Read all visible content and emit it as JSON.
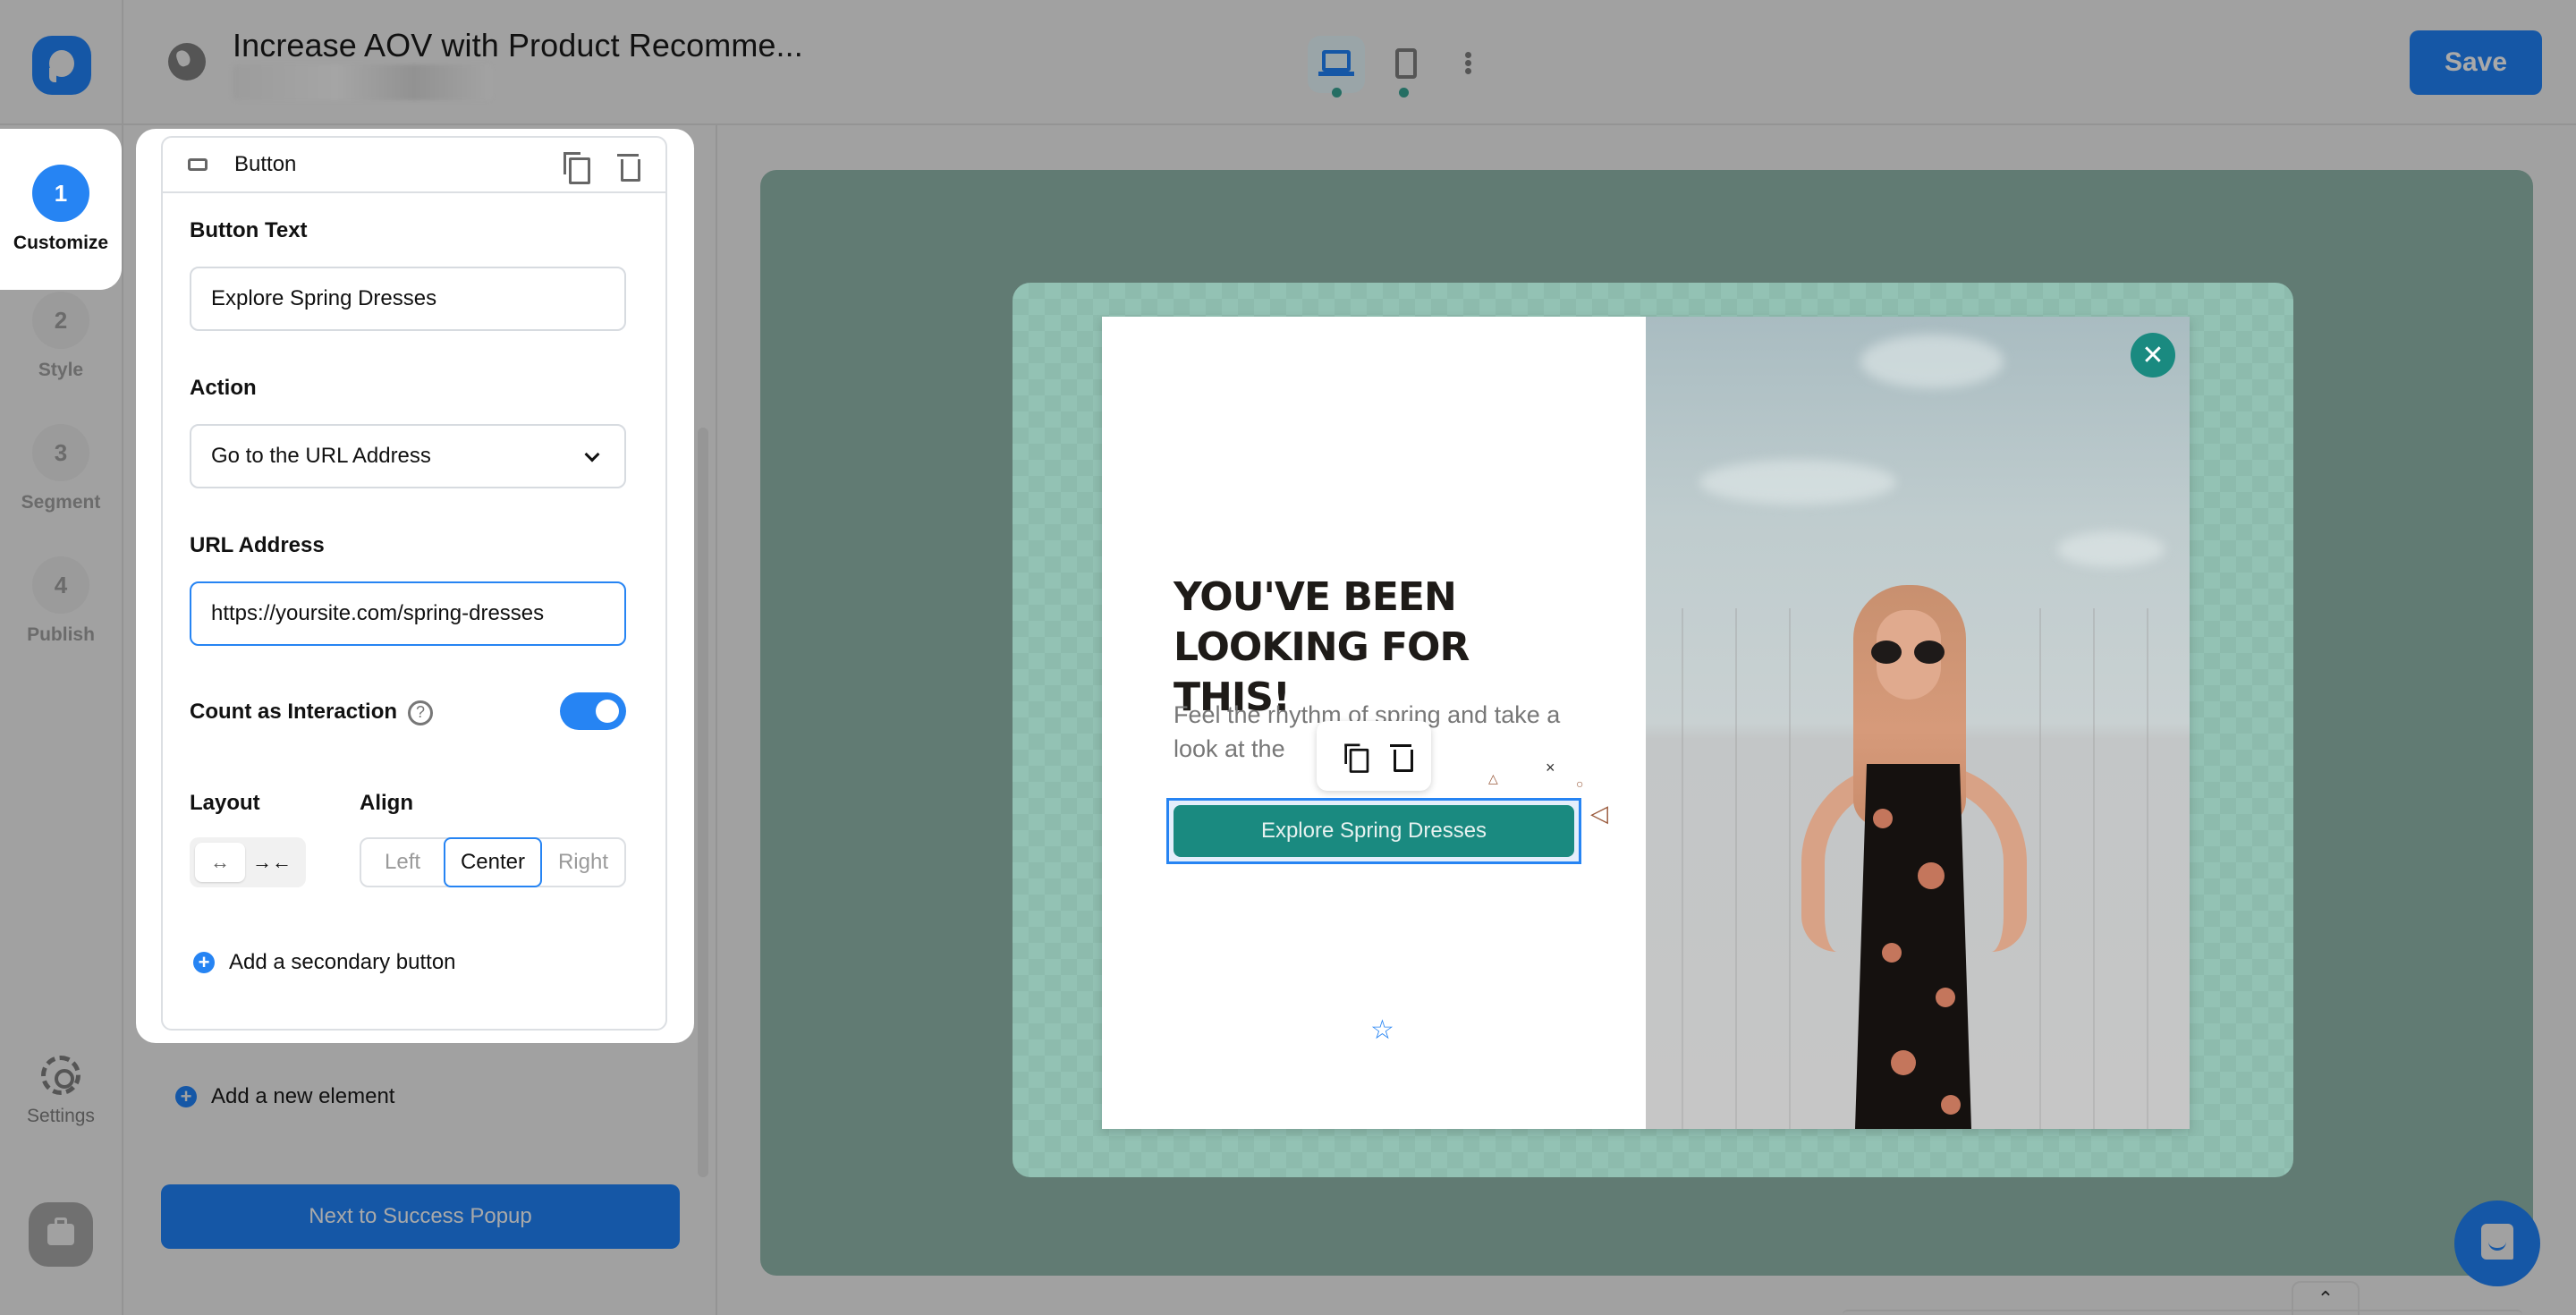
{
  "header": {
    "title": "Increase AOV with Product Recomme...",
    "save_label": "Save",
    "devices": [
      {
        "name": "desktop",
        "active": true
      },
      {
        "name": "mobile",
        "active": false
      }
    ]
  },
  "steps": [
    {
      "number": "1",
      "label": "Customize",
      "active": true
    },
    {
      "number": "2",
      "label": "Style",
      "active": false
    },
    {
      "number": "3",
      "label": "Segment",
      "active": false
    },
    {
      "number": "4",
      "label": "Publish",
      "active": false
    }
  ],
  "rail": {
    "settings_label": "Settings"
  },
  "panel": {
    "element_title": "Button",
    "button_text": {
      "label": "Button Text",
      "value": "Explore Spring Dresses"
    },
    "action": {
      "label": "Action",
      "selected": "Go to the URL Address"
    },
    "url": {
      "label": "URL Address",
      "value": "https://yoursite.com/spring-dresses"
    },
    "count_interaction": {
      "label": "Count as Interaction",
      "help": "?",
      "enabled": true
    },
    "layout": {
      "label": "Layout",
      "options": [
        "↔",
        "→←"
      ],
      "selected": 0
    },
    "align": {
      "label": "Align",
      "options": [
        "Left",
        "Center",
        "Right"
      ],
      "selected": "Center"
    },
    "add_secondary": "Add a secondary button",
    "add_element": "Add a new element",
    "next_button": "Next to Success Popup"
  },
  "popup": {
    "headline": "YOU'VE BEEN LOOKING FOR THIS!",
    "body": "Feel the rhythm of spring and take a look at the",
    "cta": "Explore Spring Dresses",
    "close_symbol": "✕",
    "accent_color": "#1a8a80"
  },
  "colors": {
    "primary": "#2684f3",
    "brand_dimmed": "#1557a6",
    "canvas_bg": "#617b73",
    "overlay_bg": "#93c2b4"
  },
  "icons": {
    "plus": "+",
    "chevron_up": "⌃",
    "star": "☆"
  }
}
